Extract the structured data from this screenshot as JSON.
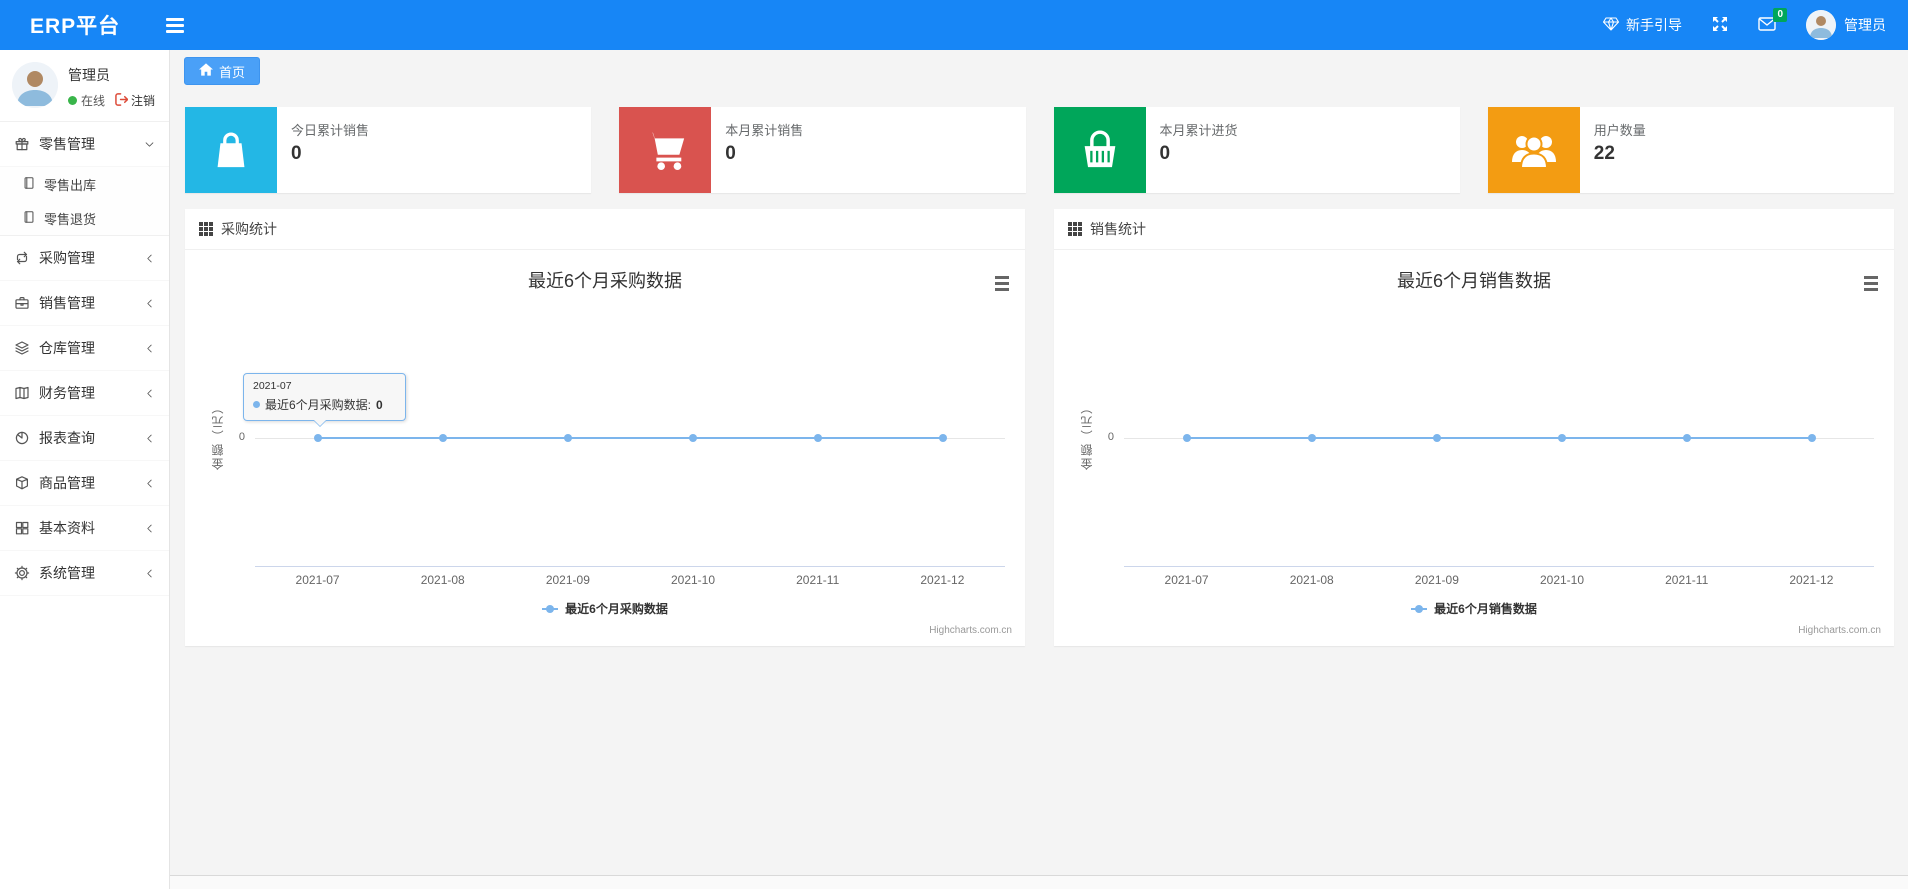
{
  "navbar": {
    "brand": "ERP平台",
    "guide_label": "新手引导",
    "message_count": "0",
    "user_name": "管理员",
    "background_color": "#1786f6",
    "icons": [
      "hamburger-icon",
      "gem-icon",
      "fullscreen-icon",
      "mail-icon",
      "avatar"
    ]
  },
  "sidebar": {
    "user": {
      "name": "管理员",
      "status": "在线",
      "logout_label": "注销",
      "online_color": "#39b54a",
      "logout_color": "#dd4b39"
    },
    "menu": [
      {
        "label": "零售管理",
        "icon": "gift-icon",
        "state": "expanded",
        "children": [
          {
            "label": "零售出库",
            "icon": "file-icon"
          },
          {
            "label": "零售退货",
            "icon": "file-icon"
          }
        ]
      },
      {
        "label": "采购管理",
        "icon": "repeat-icon",
        "state": "collapsed"
      },
      {
        "label": "销售管理",
        "icon": "briefcase-icon",
        "state": "collapsed"
      },
      {
        "label": "仓库管理",
        "icon": "layers-icon",
        "state": "collapsed"
      },
      {
        "label": "财务管理",
        "icon": "ledger-icon",
        "state": "collapsed"
      },
      {
        "label": "报表查询",
        "icon": "pie-chart-icon",
        "state": "collapsed"
      },
      {
        "label": "商品管理",
        "icon": "cube-icon",
        "state": "collapsed"
      },
      {
        "label": "基本资料",
        "icon": "grid-icon",
        "state": "collapsed"
      },
      {
        "label": "系统管理",
        "icon": "gear-icon",
        "state": "collapsed"
      }
    ]
  },
  "breadcrumb": {
    "home": "首页",
    "icon": "home-icon",
    "color": "#4aa0f7"
  },
  "cards": [
    {
      "label": "今日累计销售",
      "value": "0",
      "color": "#23b7e5",
      "icon": "shopping-bag-icon"
    },
    {
      "label": "本月累计销售",
      "value": "0",
      "color": "#d9534f",
      "icon": "shopping-cart-icon"
    },
    {
      "label": "本月累计进货",
      "value": "0",
      "color": "#00a65a",
      "icon": "shopping-basket-icon"
    },
    {
      "label": "用户数量",
      "value": "22",
      "color": "#f39c12",
      "icon": "users-icon"
    }
  ],
  "chart_data": [
    {
      "type": "line",
      "panel_title": "采购统计",
      "panel_icon": "th-grid-icon",
      "title": "最近6个月采购数据",
      "categories": [
        "2021-07",
        "2021-08",
        "2021-09",
        "2021-10",
        "2021-11",
        "2021-12"
      ],
      "series": [
        {
          "name": "最近6个月采购数据",
          "values": [
            0,
            0,
            0,
            0,
            0,
            0
          ],
          "color": "#7cb5ec"
        }
      ],
      "xlabel": "",
      "ylabel": "金额（元）",
      "ytick": "0",
      "ylim": [
        0,
        0
      ],
      "grid": false,
      "legend_position": "bottom",
      "credits": "Highcharts.com.cn",
      "tooltip": {
        "header": "2021-07",
        "series": "最近6个月采购数据:",
        "value": "0"
      }
    },
    {
      "type": "line",
      "panel_title": "销售统计",
      "panel_icon": "th-grid-icon",
      "title": "最近6个月销售数据",
      "categories": [
        "2021-07",
        "2021-08",
        "2021-09",
        "2021-10",
        "2021-11",
        "2021-12"
      ],
      "series": [
        {
          "name": "最近6个月销售数据",
          "values": [
            0,
            0,
            0,
            0,
            0,
            0
          ],
          "color": "#7cb5ec"
        }
      ],
      "xlabel": "",
      "ylabel": "金额（元）",
      "ytick": "0",
      "ylim": [
        0,
        0
      ],
      "grid": false,
      "legend_position": "bottom",
      "credits": "Highcharts.com.cn"
    }
  ]
}
